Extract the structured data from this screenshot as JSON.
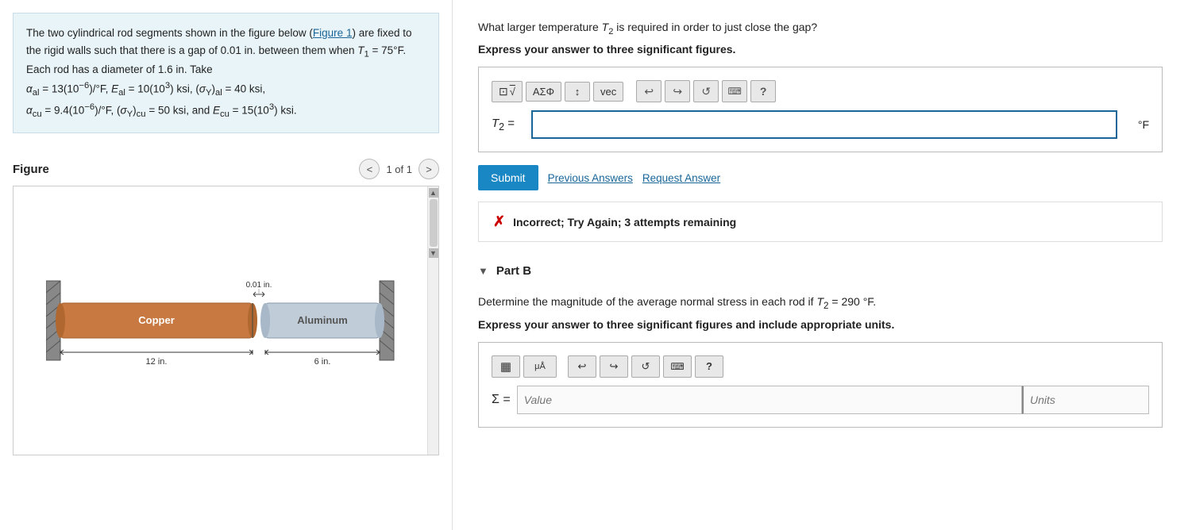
{
  "left": {
    "problem_text_parts": [
      "The two cylindrical rod segments shown in the figure below (",
      "Figure 1",
      ") are fixed to the rigid walls such that there is a gap of 0.01 in. between them when ",
      "T₁ = 75°F",
      ". Each rod has a diameter of 1.6 in. Take",
      "α_al = 13(10⁻⁶)/°F, E_al = 10(10³) ksi, (σ_Y)_al = 40 ksi,",
      "α_cu = 9.4(10⁻⁶)/°F, (σ_Y)_cu = 50 ksi, and E_cu = 15(10³) ksi."
    ],
    "figure_label": "Figure",
    "nav_label": "1 of 1",
    "nav_prev": "<",
    "nav_next": ">",
    "rod_labels": {
      "copper": "Copper",
      "aluminum": "Aluminum",
      "gap": "0.01 in.",
      "dim1": "12 in.",
      "dim2": "6 in."
    }
  },
  "right": {
    "question_a": "What larger temperature T₂ is required in order to just close the gap?",
    "express_a": "Express your answer to three significant figures.",
    "answer_label_a": "T₂ =",
    "unit_a": "°F",
    "toolbar_a": {
      "matrix_icon": "⊞",
      "vo_icon": "√̄",
      "sigma_icon": "ΑΣΦ",
      "sort_icon": "↕",
      "vec_icon": "vec",
      "undo_icon": "↩",
      "redo_icon": "↪",
      "refresh_icon": "↺",
      "keyboard_icon": "⌨",
      "help_icon": "?"
    },
    "submit_label": "Submit",
    "prev_answers_label": "Previous Answers",
    "request_answer_label": "Request Answer",
    "incorrect_message": "Incorrect; Try Again; 3 attempts remaining",
    "part_b_label": "Part B",
    "question_b": "Determine the magnitude of the average normal stress in each rod if T₂ = 290 °F.",
    "express_b": "Express your answer to three significant figures and include appropriate units.",
    "sigma_label": "Σ =",
    "value_placeholder": "Value",
    "units_placeholder": "Units",
    "toolbar_b": {
      "grid_icon": "▦",
      "mu_icon": "μÅ",
      "undo_icon": "↩",
      "redo_icon": "↪",
      "refresh_icon": "↺",
      "keyboard_icon": "⌨",
      "help_icon": "?"
    }
  },
  "colors": {
    "blue": "#1a87c5",
    "link_blue": "#1a6699",
    "error_red": "#cc0000",
    "copper_color": "#c87941",
    "aluminum_color": "#a8b8c8",
    "input_border_blue": "#1a6699"
  }
}
